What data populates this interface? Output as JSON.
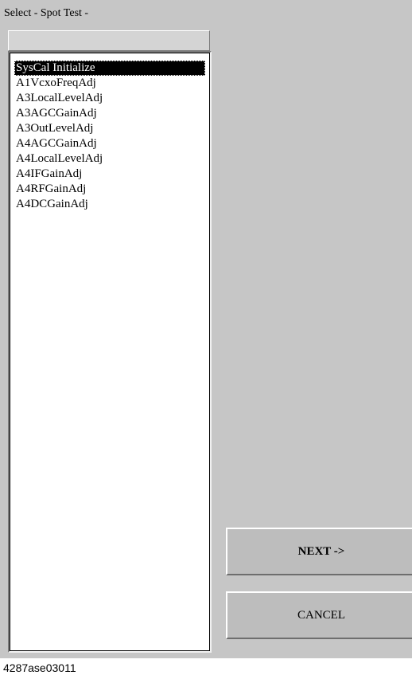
{
  "window": {
    "title": "Select - Spot Test -"
  },
  "test_list": {
    "header": "",
    "selected_index": 0,
    "items": [
      "SysCal Initialize",
      "A1VcxoFreqAdj",
      "A3LocalLevelAdj",
      "A3AGCGainAdj",
      "A3OutLevelAdj",
      "A4AGCGainAdj",
      "A4LocalLevelAdj",
      "A4IFGainAdj",
      "A4RFGainAdj",
      "A4DCGainAdj"
    ]
  },
  "buttons": {
    "next_label": "NEXT ->",
    "cancel_label": "CANCEL"
  },
  "figure": {
    "id": "4287ase03011"
  }
}
